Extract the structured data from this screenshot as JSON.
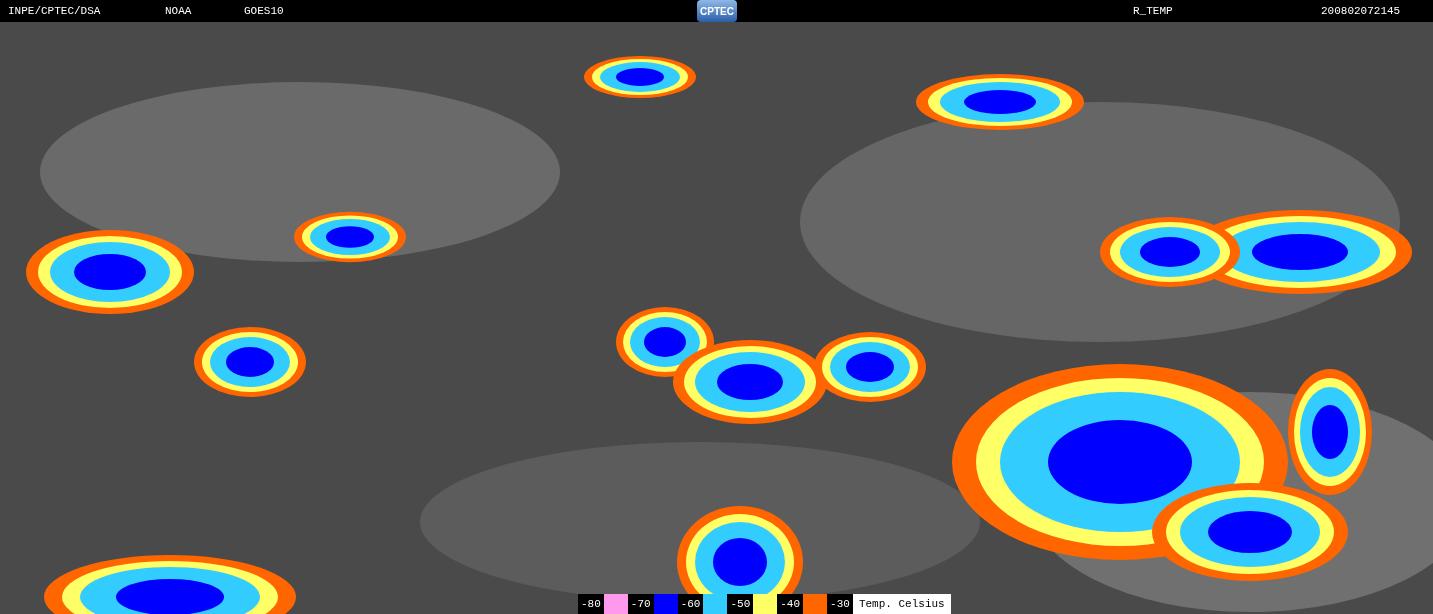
{
  "header": {
    "source": "INPE/CPTEC/DSA",
    "agency": "NOAA",
    "satellite": "GOES10",
    "logo": "CPTEC",
    "product": "R_TEMP",
    "timestamp": "200802072145"
  },
  "legend": {
    "items": [
      {
        "label": "-80",
        "color": "#ff99ee"
      },
      {
        "label": "-70",
        "color": "#0000ff"
      },
      {
        "label": "-60",
        "color": "#33ccff"
      },
      {
        "label": "-50",
        "color": "#ffff66"
      },
      {
        "label": "-40",
        "color": "#ff6600"
      },
      {
        "label": "-30"
      }
    ],
    "unit": "Temp. Celsius"
  }
}
